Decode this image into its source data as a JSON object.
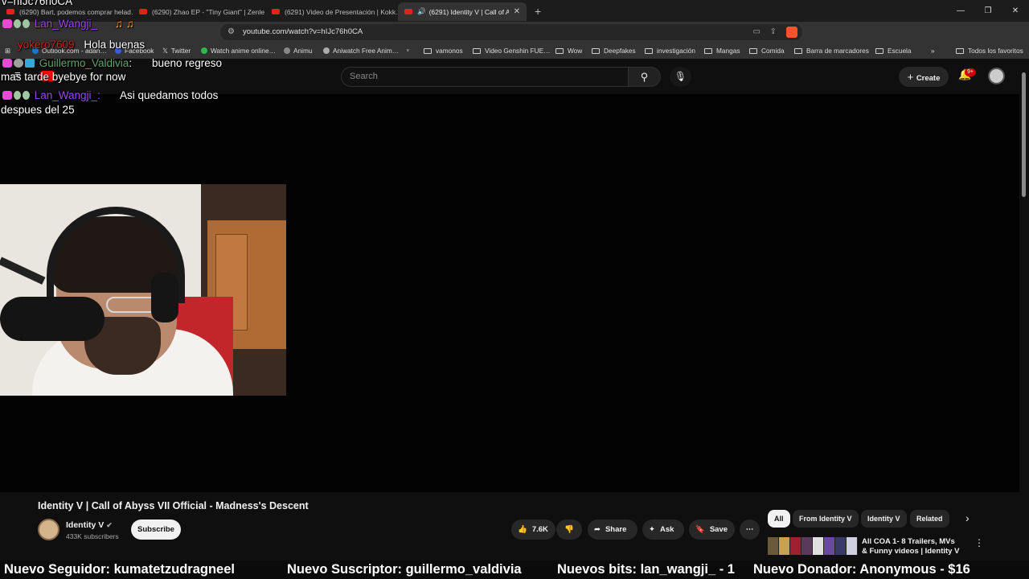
{
  "browser": {
    "tabs": [
      {
        "label": "(6290) Bart, podemos comprar helad…",
        "active": false
      },
      {
        "label": "(6290) Zhao EP - \"Tiny Giant\" | Zenle…",
        "active": false
      },
      {
        "label": "(6291) Video de Presentación | Kokk…",
        "active": false
      },
      {
        "label": "(6291) Identity V | Call of Aby…",
        "active": true
      }
    ],
    "url": "youtube.com/watch?v=hIJc76h0CA",
    "bookmarks": [
      "Outlook.com - adan…",
      "Facebook",
      "Twitter",
      "Watch anime online…",
      "Animu",
      "Aniwatch Free Anim…",
      "vamonos",
      "Video Genshin FUE…",
      "Wow",
      "Deepfakes",
      "investigación",
      "Mangas",
      "Comida",
      "Barra de marcadores",
      "Escuela",
      "Todos los favoritos"
    ]
  },
  "youtube": {
    "search_placeholder": "Search",
    "create_label": "Create",
    "notif_badge": "9+",
    "video_title": "Identity V | Call of Abyss VII Official - Madness's Descent",
    "channel_name": "Identity V",
    "channel_subs": "433K subscribers",
    "subscribe_label": "Subscribe",
    "likes": "7.6K",
    "share_label": "Share",
    "ask_label": "Ask",
    "save_label": "Save",
    "chips": [
      "All",
      "From Identity V",
      "Identity V",
      "Related"
    ],
    "rec_title": "All COA 1- 8 Trailers, MVs & Funny videos | Identity V"
  },
  "chat": [
    {
      "user": "Lan_Wangji_",
      "message": ""
    },
    {
      "user": "yokero7609",
      "message": "Hola buenas"
    },
    {
      "user": "Guillermo_Valdivia",
      "message": "bueno regreso mas tarde byebye for now"
    },
    {
      "user": "Lan_Wangji_",
      "message": "Asi quedamos todos despues del 25"
    }
  ],
  "chat_top_text": "v=hIJc76h0CA",
  "ticker": [
    "Nuevo Seguidor: kumatetzudragneel",
    "Nuevo Suscriptor: guillermo_valdivia",
    "Nuevos bits: lan_wangji_ - 1",
    "Nuevo Donador: Anonymous - $16"
  ]
}
